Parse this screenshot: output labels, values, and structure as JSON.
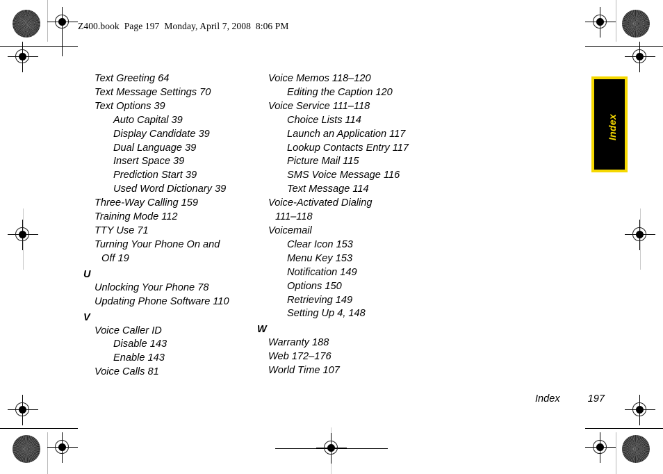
{
  "header": {
    "text": "Z400.book  Page 197  Monday, April 7, 2008  8:06 PM"
  },
  "thumb_tab": {
    "label": "Index",
    "background_color": "#000000",
    "border_color": "#f5d800",
    "text_color": "#f5d800"
  },
  "footer": {
    "label": "Index",
    "page_number": "197"
  },
  "index": {
    "left_column": [
      {
        "type": "entry",
        "level": 1,
        "text": "Text Greeting 64"
      },
      {
        "type": "entry",
        "level": 1,
        "text": "Text Message Settings 70"
      },
      {
        "type": "entry",
        "level": 1,
        "text": "Text Options 39"
      },
      {
        "type": "entry",
        "level": 2,
        "text": "Auto Capital 39"
      },
      {
        "type": "entry",
        "level": 2,
        "text": "Display Candidate 39"
      },
      {
        "type": "entry",
        "level": 2,
        "text": "Dual Language 39"
      },
      {
        "type": "entry",
        "level": 2,
        "text": "Insert Space 39"
      },
      {
        "type": "entry",
        "level": 2,
        "text": "Prediction Start 39"
      },
      {
        "type": "entry",
        "level": 2,
        "text": "Used Word Dictionary 39"
      },
      {
        "type": "entry",
        "level": 1,
        "text": "Three-Way Calling 159"
      },
      {
        "type": "entry",
        "level": 1,
        "text": "Training Mode 112"
      },
      {
        "type": "entry",
        "level": 1,
        "text": "TTY Use 71"
      },
      {
        "type": "entry",
        "level": 1,
        "text": "Turning Your Phone On and"
      },
      {
        "type": "continuation",
        "text": "Off 19"
      },
      {
        "type": "letter",
        "text": "U"
      },
      {
        "type": "entry",
        "level": 1,
        "text": "Unlocking Your Phone 78"
      },
      {
        "type": "entry",
        "level": 1,
        "text": "Updating Phone Software 110"
      },
      {
        "type": "letter",
        "text": "V"
      },
      {
        "type": "entry",
        "level": 1,
        "text": "Voice Caller ID"
      },
      {
        "type": "entry",
        "level": 2,
        "text": "Disable 143"
      },
      {
        "type": "entry",
        "level": 2,
        "text": "Enable 143"
      },
      {
        "type": "entry",
        "level": 1,
        "text": "Voice Calls 81"
      }
    ],
    "right_column": [
      {
        "type": "entry",
        "level": 1,
        "text": "Voice Memos 118–120"
      },
      {
        "type": "entry",
        "level": 2,
        "text": "Editing the Caption 120"
      },
      {
        "type": "entry",
        "level": 1,
        "text": "Voice Service 111–118"
      },
      {
        "type": "entry",
        "level": 2,
        "text": "Choice Lists 114"
      },
      {
        "type": "entry",
        "level": 2,
        "text": "Launch an Application 117"
      },
      {
        "type": "entry",
        "level": 2,
        "text": "Lookup Contacts Entry 117"
      },
      {
        "type": "entry",
        "level": 2,
        "text": "Picture Mail 115"
      },
      {
        "type": "entry",
        "level": 2,
        "text": "SMS Voice Message 116"
      },
      {
        "type": "entry",
        "level": 2,
        "text": "Text Message 114"
      },
      {
        "type": "entry",
        "level": 1,
        "text": "Voice-Activated Dialing"
      },
      {
        "type": "continuation",
        "text": "111–118"
      },
      {
        "type": "entry",
        "level": 1,
        "text": "Voicemail"
      },
      {
        "type": "entry",
        "level": 2,
        "text": "Clear Icon 153"
      },
      {
        "type": "entry",
        "level": 2,
        "text": "Menu Key 153"
      },
      {
        "type": "entry",
        "level": 2,
        "text": "Notification 149"
      },
      {
        "type": "entry",
        "level": 2,
        "text": "Options 150"
      },
      {
        "type": "entry",
        "level": 2,
        "text": "Retrieving 149"
      },
      {
        "type": "entry",
        "level": 2,
        "text": "Setting Up 4, 148"
      },
      {
        "type": "letter",
        "text": "W"
      },
      {
        "type": "entry",
        "level": 1,
        "text": "Warranty 188"
      },
      {
        "type": "entry",
        "level": 1,
        "text": "Web 172–176"
      },
      {
        "type": "entry",
        "level": 1,
        "text": "World Time 107"
      }
    ]
  }
}
